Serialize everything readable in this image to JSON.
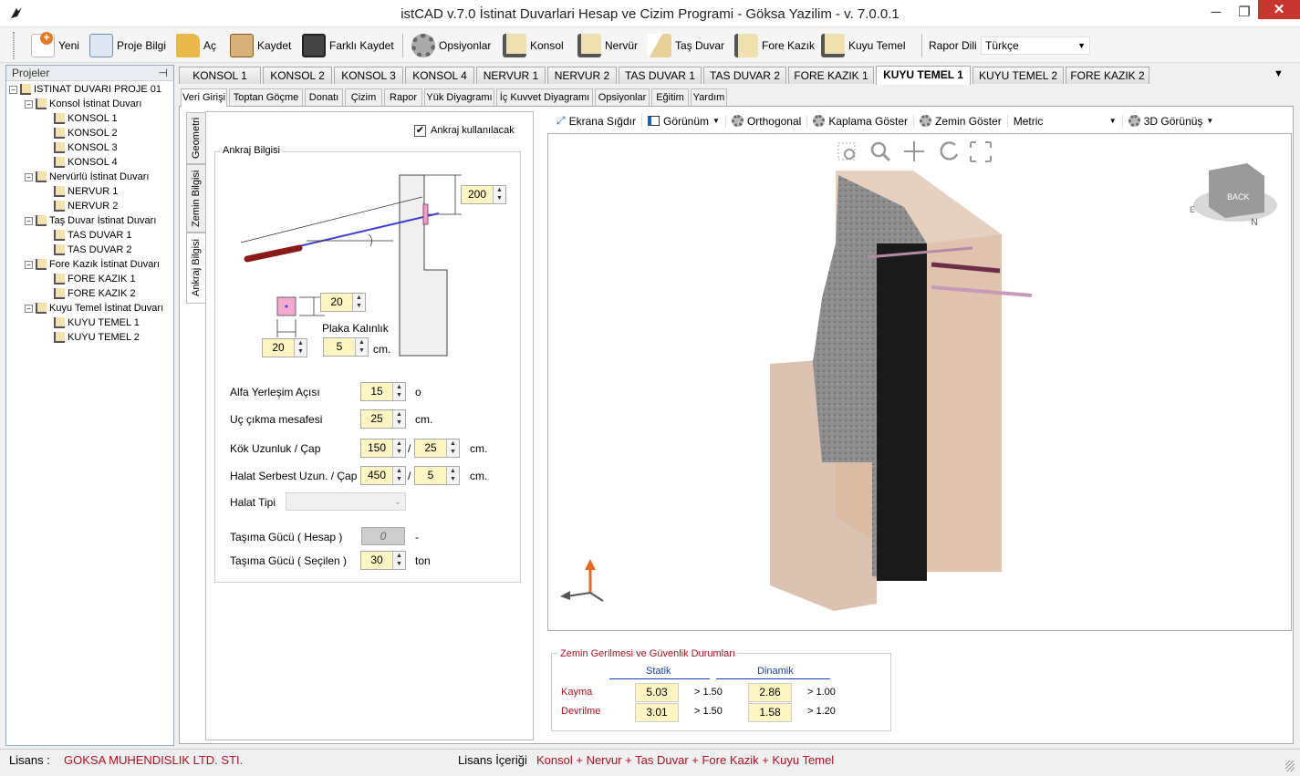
{
  "window": {
    "title": "istCAD v.7.0 İstinat Duvarlari Hesap ve Cizim Programi - Göksa Yazilim - v. 7.0.0.1",
    "minimize": "─",
    "restore": "❐",
    "close": "✕"
  },
  "toolbar": {
    "new": "Yeni",
    "project_info": "Proje Bilgi",
    "open": "Aç",
    "save": "Kaydet",
    "save_as": "Farklı Kaydet",
    "options": "Opsiyonlar",
    "konsol": "Konsol",
    "nervur": "Nervür",
    "tas_duvar": "Taş Duvar",
    "fore_kazik": "Fore Kazık",
    "kuyu_temel": "Kuyu Temel",
    "report_lang_label": "Rapor Dili",
    "report_lang_value": "Türkçe",
    "colors": {
      "new": "#e07a2a",
      "project_info": "#6b8bc5",
      "open": "#e8b84a",
      "save": "#b5813d",
      "save_as": "#555555",
      "options": "#777777",
      "konsol": "#e3cf92",
      "nervur": "#e3cf92",
      "tas_duvar": "#e3cf92",
      "fore_kazik": "#e3cf92",
      "kuyu_temel": "#e3cf92"
    }
  },
  "projects": {
    "header": "Projeler",
    "pin": "⊣",
    "root": "ISTINAT DUVARI PROJE 01",
    "groups": [
      {
        "label": "Konsol İstinat Duvarı",
        "items": [
          "KONSOL 1",
          "KONSOL 2",
          "KONSOL 3",
          "KONSOL 4"
        ]
      },
      {
        "label": "Nervürlü İstinat Duvarı",
        "items": [
          "NERVUR 1",
          "NERVUR 2"
        ]
      },
      {
        "label": "Taş Duvar İstinat Duvarı",
        "items": [
          "TAS DUVAR 1",
          "TAS DUVAR 2"
        ]
      },
      {
        "label": "Fore Kazık İstinat Duvarı",
        "items": [
          "FORE KAZIK 1",
          "FORE KAZIK 2"
        ]
      },
      {
        "label": "Kuyu Temel İstinat Duvarı",
        "items": [
          "KUYU TEMEL 1",
          "KUYU TEMEL 2"
        ]
      }
    ]
  },
  "tabs": [
    "KONSOL 1",
    "KONSOL 2",
    "KONSOL 3",
    "KONSOL 4",
    "NERVUR 1",
    "NERVUR 2",
    "TAS DUVAR 1",
    "TAS DUVAR 2",
    "FORE KAZIK 1",
    "KUYU TEMEL 1",
    "KUYU TEMEL 2",
    "FORE KAZIK 2"
  ],
  "tabs_overflow": "▼",
  "subtabs": [
    "Veri Girişi",
    "Toptan Göçme",
    "Donatı",
    "Çizim",
    "Rapor",
    "Yük Diyagramı",
    "İç Kuvvet Diyagramı",
    "Opsiyonlar",
    "Eğitim",
    "Yardım"
  ],
  "vtabs": [
    "Geometri",
    "Zemin Bilgisi",
    "Ankraj Bilgisi"
  ],
  "anchor": {
    "checkbox_label": "Ankraj kullanılacak",
    "checked": "✔",
    "group_title": "Ankraj Bilgisi",
    "dim_top": "200",
    "plate_height": "20",
    "plate_width": "20",
    "plate_thickness_label": "Plaka Kalınlık",
    "plate_thickness": "5",
    "cm": "cm.",
    "alfa_label": "Alfa Yerleşim Açısı",
    "alfa": "15",
    "alfa_unit": "o",
    "uc_label": "Uç çıkma mesafesi",
    "uc": "25",
    "uc_unit": "cm.",
    "kok_label": "Kök Uzunluk / Çap",
    "kok_len": "150",
    "kok_dia": "25",
    "kok_unit": "cm.",
    "halat_label": "Halat Serbest Uzun. / Çap",
    "halat_len": "450",
    "halat_dia": "5",
    "halat_unit": "cm.",
    "halat_tipi_label": "Halat Tipi",
    "tasima_hesap_label": "Taşıma Gücü ( Hesap )",
    "tasima_hesap": "0",
    "tasima_hesap_unit": "-",
    "tasima_secilen_label": "Taşıma Gücü ( Seçilen )",
    "tasima_secilen": "30",
    "tasima_unit": "ton",
    "slash": "/"
  },
  "viewer": {
    "fit": "Ekrana Sığdır",
    "view": "Görünüm",
    "ortho": "Orthogonal",
    "coating": "Kaplama Göster",
    "soil": "Zemin Göster",
    "units": "Metric",
    "view3d": "3D Görünüş",
    "cube_label": "BACK",
    "compass_n": "N",
    "compass_e": "E"
  },
  "results": {
    "title": "Zemin Gerilmesi ve Güvenlik Durumları",
    "static": "Statik",
    "dynamic": "Dinamik",
    "rows": [
      {
        "label": "Kayma",
        "static": "5.03",
        "static_lim": "> 1.50",
        "dyn": "2.86",
        "dyn_lim": "> 1.00"
      },
      {
        "label": "Devrilme",
        "static": "3.01",
        "static_lim": "> 1.50",
        "dyn": "1.58",
        "dyn_lim": "> 1.20"
      }
    ]
  },
  "status": {
    "license_label": "Lisans :",
    "license_value": "GOKSA MUHENDISLIK LTD. STI.",
    "content_label": "Lisans İçeriği",
    "content_value": "Konsol + Nervur + Tas Duvar + Fore Kazik + Kuyu Temel"
  }
}
